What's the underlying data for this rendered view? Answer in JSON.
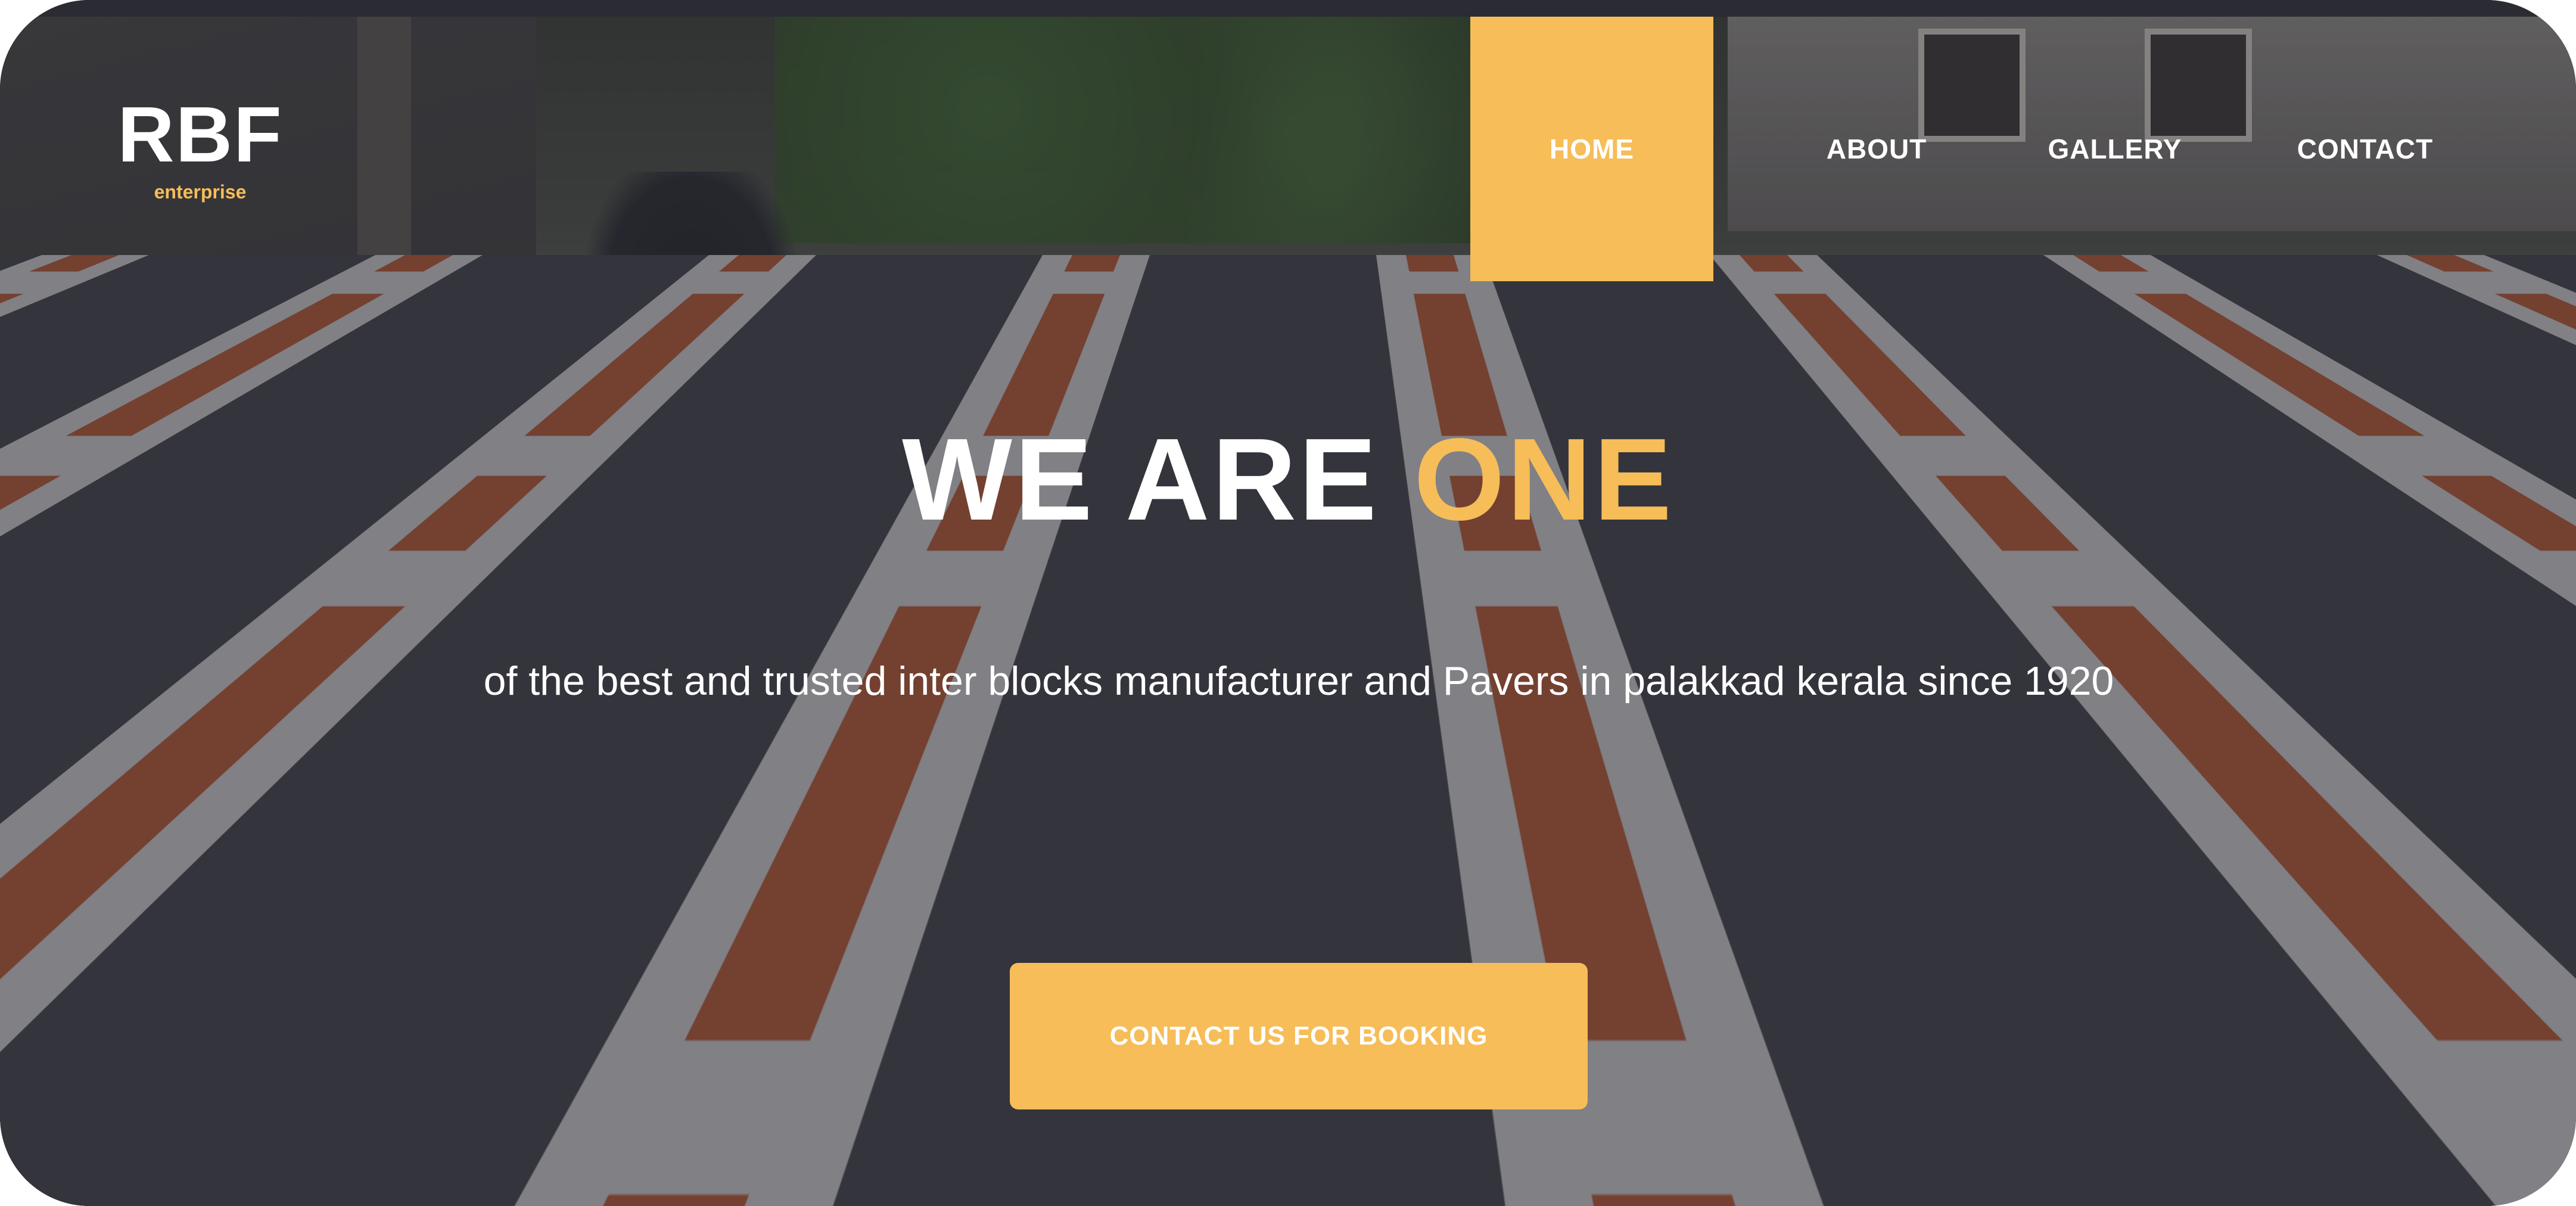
{
  "brand": {
    "name": "RBF",
    "tagline": "enterprise"
  },
  "nav": {
    "items": [
      {
        "label": "HOME",
        "active": true
      },
      {
        "label": "ABOUT",
        "active": false
      },
      {
        "label": "GALLERY",
        "active": false
      },
      {
        "label": "CONTACT",
        "active": false
      }
    ]
  },
  "hero": {
    "title_main": "WE ARE ",
    "title_accent": "ONE",
    "subtitle": "of the best and trusted inter blocks manufacturer and Pavers in palakkad kerala since 1920",
    "cta_label": "CONTACT US FOR BOOKING"
  },
  "colors": {
    "accent": "#f6bd58",
    "text": "#ffffff",
    "overlay": "#28283280"
  }
}
